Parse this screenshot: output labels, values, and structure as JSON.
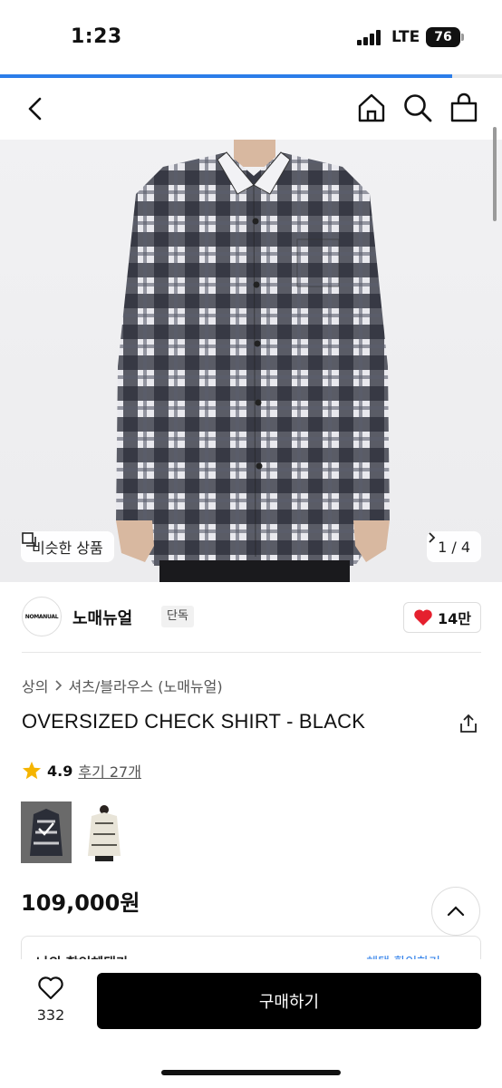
{
  "status_bar": {
    "time": "1:23",
    "network": "LTE",
    "battery": "76"
  },
  "colors": {
    "accent": "#2b7de9",
    "heart": "#e5202e",
    "star": "#f5b400",
    "buy_button": "#000000"
  },
  "load_progress": 0.9,
  "nav": {
    "icons": [
      "chevron-left-icon",
      "home-icon",
      "search-icon",
      "shopping-bag-icon"
    ]
  },
  "hero": {
    "similar_label": "비슷한 상품",
    "page_indicator": "1 / 4"
  },
  "brand": {
    "logo_text": "NOMANUAL",
    "name": "노매뉴얼",
    "tag": "단독",
    "likes": "14만"
  },
  "breadcrumb": {
    "category": "상의",
    "sub": "셔츠/블라우스 (노매뉴얼)"
  },
  "product": {
    "title": "OVERSIZED CHECK SHIRT - BLACK",
    "rating": "4.9",
    "reviews": "후기 27개",
    "price": "109,000원"
  },
  "benefit": {
    "left": "나의 할인혜택가",
    "right": "혜택 확인하기"
  },
  "bottom_bar": {
    "wish_count": "332",
    "buy_label": "구매하기"
  }
}
